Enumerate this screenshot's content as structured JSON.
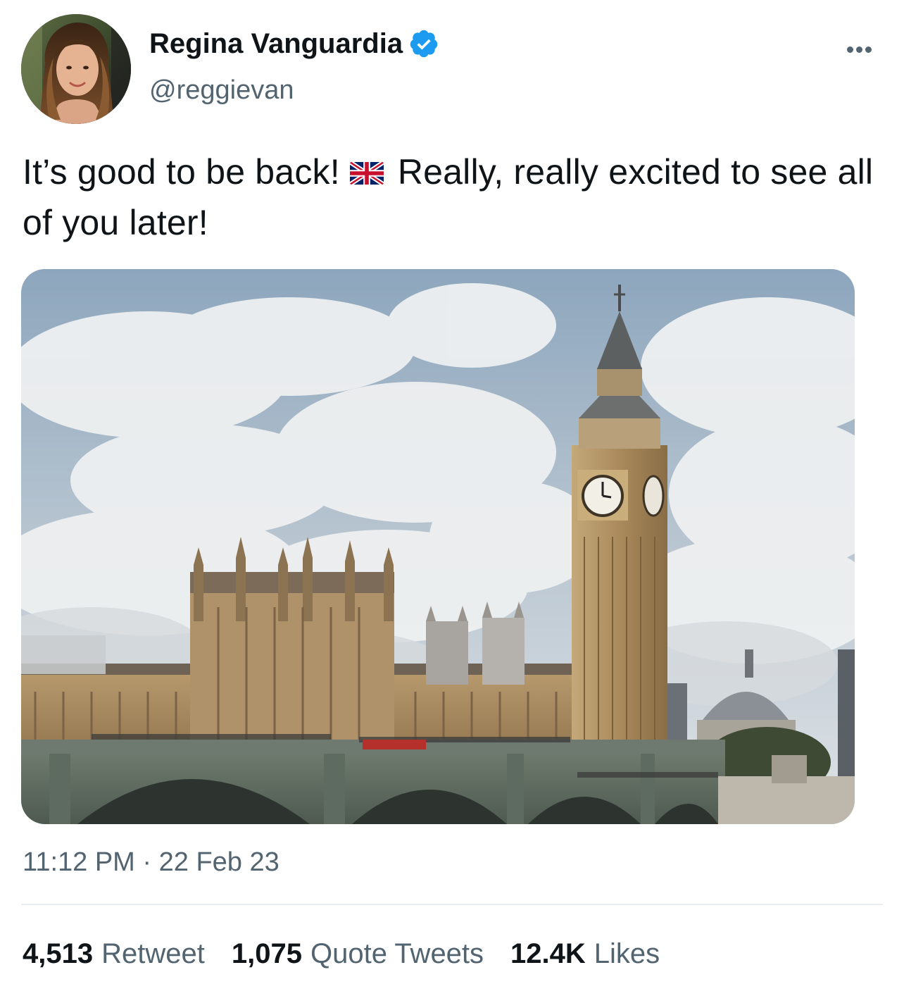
{
  "author": {
    "display_name": "Regina Vanguardia",
    "handle": "@reggievan",
    "verified": true,
    "verified_color": "#1d9bf0"
  },
  "tweet": {
    "text_part1": "It’s good to be back!",
    "flag_emoji": "gb-flag-icon",
    "text_part2": "Really, really excited to see all of you later!",
    "time": "11:12 PM",
    "date": "22 Feb 23"
  },
  "stats": {
    "retweets_count": "4,513",
    "retweets_label": "Retweet",
    "quotes_count": "1,075",
    "quotes_label": "Quote Tweets",
    "likes_count": "12.4K",
    "likes_label": "Likes"
  },
  "colors": {
    "text_primary": "#0f1419",
    "text_secondary": "#536471",
    "divider": "#e6ecf0"
  }
}
